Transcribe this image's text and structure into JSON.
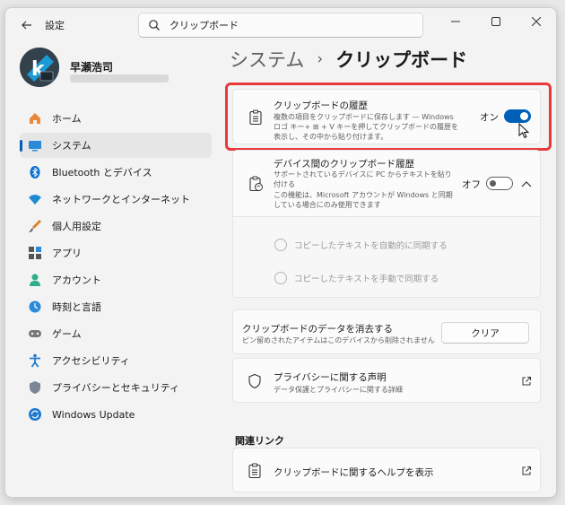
{
  "app": {
    "title": "設定"
  },
  "search": {
    "value": "クリップボード"
  },
  "user": {
    "name": "早瀬浩司"
  },
  "sidebar": {
    "items": [
      {
        "label": "ホーム",
        "icon": "home-icon"
      },
      {
        "label": "システム",
        "icon": "system-icon",
        "active": true
      },
      {
        "label": "Bluetooth とデバイス",
        "icon": "bluetooth-icon"
      },
      {
        "label": "ネットワークとインターネット",
        "icon": "wifi-icon"
      },
      {
        "label": "個人用設定",
        "icon": "brush-icon"
      },
      {
        "label": "アプリ",
        "icon": "apps-icon"
      },
      {
        "label": "アカウント",
        "icon": "account-icon"
      },
      {
        "label": "時刻と言語",
        "icon": "clock-icon"
      },
      {
        "label": "ゲーム",
        "icon": "gamepad-icon"
      },
      {
        "label": "アクセシビリティ",
        "icon": "accessibility-icon"
      },
      {
        "label": "プライバシーとセキュリティ",
        "icon": "shield-icon"
      },
      {
        "label": "Windows Update",
        "icon": "update-icon"
      }
    ]
  },
  "breadcrumb": {
    "parent": "システム",
    "separator": "›",
    "current": "クリップボード"
  },
  "history": {
    "title": "クリップボードの履歴",
    "desc": "複数の項目をクリップボードに保存します — Windows ロゴ キー+ ⊞ + V キーを押してクリップボードの履歴を表示し、その中から貼り付けます。",
    "state_label": "オン",
    "enabled": true
  },
  "sync": {
    "title": "デバイス間のクリップボード履歴",
    "desc1": "サポートされているデバイスに PC からテキストを貼り付ける",
    "desc2": "この機能は、Microsoft アカウントが Windows と同期している場合にのみ使用できます",
    "state_label": "オフ",
    "enabled": false,
    "options": [
      "コピーしたテキストを自動的に同期する",
      "コピーしたテキストを手動で同期する"
    ]
  },
  "clear": {
    "title": "クリップボードのデータを消去する",
    "desc": "ピン留めされたアイテムはこのデバイスから削除されません",
    "button": "クリア"
  },
  "privacy": {
    "title": "プライバシーに関する声明",
    "desc": "データ保護とプライバシーに関する詳細"
  },
  "related": {
    "heading": "関連リンク",
    "help": "クリップボードに関するヘルプを表示"
  },
  "colors": {
    "accent": "#005fb8",
    "highlight": "#e8393c"
  }
}
